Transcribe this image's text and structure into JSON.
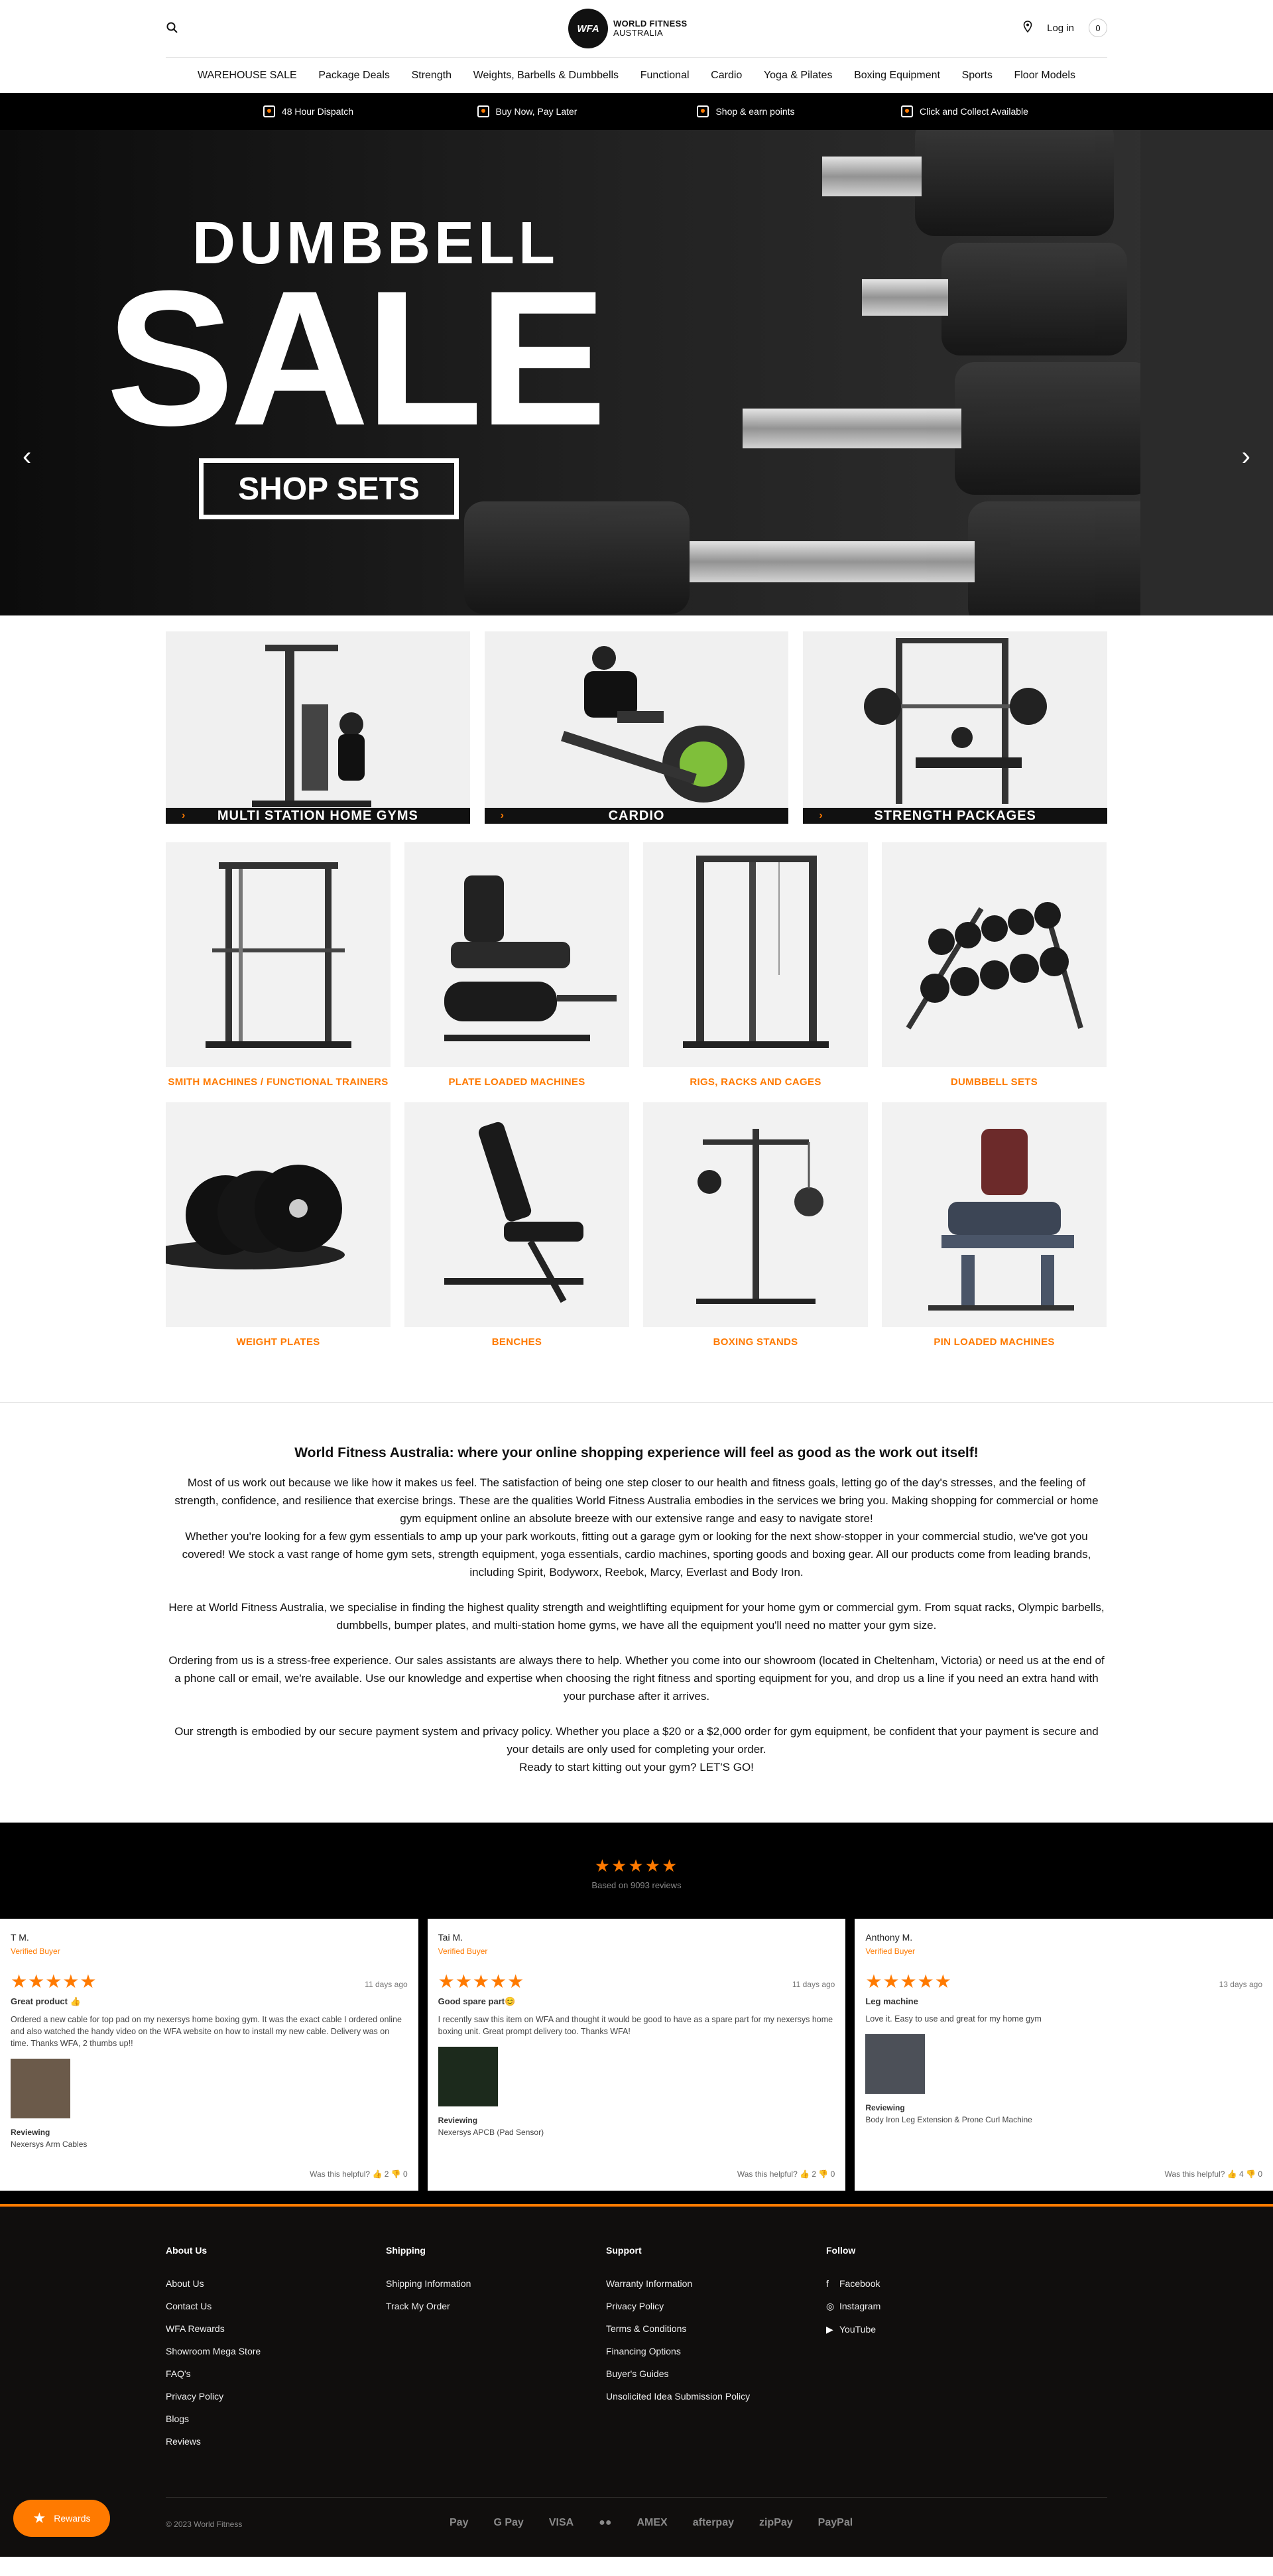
{
  "header": {
    "logo_mark": "WFA",
    "logo_line1": "WORLD FITNESS",
    "logo_line2": "AUSTRALIA",
    "login": "Log in",
    "cart_count": "0"
  },
  "nav": [
    "WAREHOUSE SALE",
    "Package Deals",
    "Strength",
    "Weights, Barbells & Dumbbells",
    "Functional",
    "Cardio",
    "Yoga & Pilates",
    "Boxing Equipment",
    "Sports",
    "Floor Models"
  ],
  "benefits": [
    "48 Hour Dispatch",
    "Buy Now, Pay Later",
    "Shop & earn points",
    "Click and Collect Available"
  ],
  "hero": {
    "subtitle": "DUMBBELL",
    "title": "SALE",
    "cta": "SHOP SETS",
    "prev": "‹",
    "next": "›"
  },
  "featured": [
    "MULTI STATION HOME GYMS",
    "CARDIO",
    "STRENGTH PACKAGES"
  ],
  "categories": [
    "SMITH MACHINES / FUNCTIONAL TRAINERS",
    "PLATE LOADED MACHINES",
    "RIGS, RACKS AND CAGES",
    "DUMBBELL SETS",
    "WEIGHT PLATES",
    "BENCHES",
    "BOXING STANDS",
    "PIN LOADED MACHINES"
  ],
  "intro": {
    "heading": "World Fitness Australia: where your online shopping experience will feel as good as the work out itself!",
    "p1": "Most of us work out because we like how it makes us feel. The satisfaction of being one step closer to our health and fitness goals, letting go of the day's stresses, and the feeling of strength, confidence, and resilience that exercise brings. These are the qualities World Fitness Australia embodies in the services we bring you. Making shopping for commercial or home gym equipment online an absolute breeze with our extensive range and easy to navigate store!",
    "p2": "Whether you're looking for a few gym essentials to amp up your park workouts, fitting out a garage gym or looking for the next show-stopper in your commercial studio, we've got you covered! We stock a vast range of home gym sets, strength equipment, yoga essentials, cardio machines, sporting goods and boxing gear. All our products come from leading brands, including Spirit, Bodyworx, Reebok, Marcy, Everlast and Body Iron.",
    "p3": "Here at World Fitness Australia, we specialise in finding the highest quality strength and weightlifting equipment for your home gym or commercial gym. From squat racks, Olympic barbells, dumbbells, bumper plates, and multi-station home gyms, we have all the equipment you'll need no matter your gym size.",
    "p4": "Ordering from us is a stress-free experience. Our sales assistants are always there to help. Whether you come into our showroom (located in Cheltenham, Victoria) or need us at the end of a phone call or email, we're available. Use our knowledge and expertise when choosing the right fitness and sporting equipment for you, and drop us a line if you need an extra hand with your purchase after it arrives.",
    "p5": "Our strength is embodied by our secure payment system and privacy policy. Whether you place a $20 or a $2,000 order for gym equipment, be confident that your payment is secure and your details are only used for completing your order.",
    "p6": "Ready to start kitting out your gym? LET'S GO!"
  },
  "reviews": {
    "stars": "★★★★★",
    "based_on": "Based on 9093 reviews",
    "items": [
      {
        "name": "T M.",
        "verified": "Verified Buyer",
        "date": "11 days ago",
        "title": "Great product 👍",
        "body": "Ordered a new cable for top pad on my nexersys home boxing gym. It was the exact cable I ordered online and also watched the handy video on the WFA website on how to install my new cable. Delivery was on time. Thanks WFA, 2 thumbs up!!",
        "reviewing": "Reviewing",
        "product": "Nexersys Arm Cables",
        "helpful": "Was this helpful?  👍 2  👎 0"
      },
      {
        "name": "Tai M.",
        "verified": "Verified Buyer",
        "date": "11 days ago",
        "title": "Good spare part😊",
        "body": "I recently saw this item on WFA and thought it would be good to have as a spare part for my nexersys home boxing unit. Great prompt delivery too. Thanks WFA!",
        "reviewing": "Reviewing",
        "product": "Nexersys APCB (Pad Sensor)",
        "helpful": "Was this helpful?  👍 2  👎 0"
      },
      {
        "name": "Anthony M.",
        "verified": "Verified Buyer",
        "date": "13 days ago",
        "title": "Leg machine",
        "body": "Love it. Easy to use and great for my home gym",
        "reviewing": "Reviewing",
        "product": "Body Iron Leg Extension & Prone Curl Machine",
        "helpful": "Was this helpful?  👍 4  👎 0"
      }
    ]
  },
  "footer": {
    "about": {
      "title": "About Us",
      "links": [
        "About Us",
        "Contact Us",
        "WFA Rewards",
        "Showroom Mega Store",
        "FAQ's",
        "Privacy Policy",
        "Blogs",
        "Reviews"
      ]
    },
    "shipping": {
      "title": "Shipping",
      "links": [
        "Shipping Information",
        "Track My Order"
      ]
    },
    "support": {
      "title": "Support",
      "links": [
        "Warranty Information",
        "Privacy Policy",
        "Terms & Conditions",
        "Financing Options",
        "Buyer's Guides",
        "Unsolicited Idea Submission Policy"
      ]
    },
    "follow": {
      "title": "Follow",
      "links": [
        "Facebook",
        "Instagram",
        "YouTube"
      ]
    },
    "copyright": "© 2023 World Fitness",
    "payments": [
      "Pay",
      "G Pay",
      "VISA",
      "●●",
      "AMEX",
      "afterpay",
      "zipPay",
      "PayPal"
    ],
    "rewards": "Rewards"
  }
}
